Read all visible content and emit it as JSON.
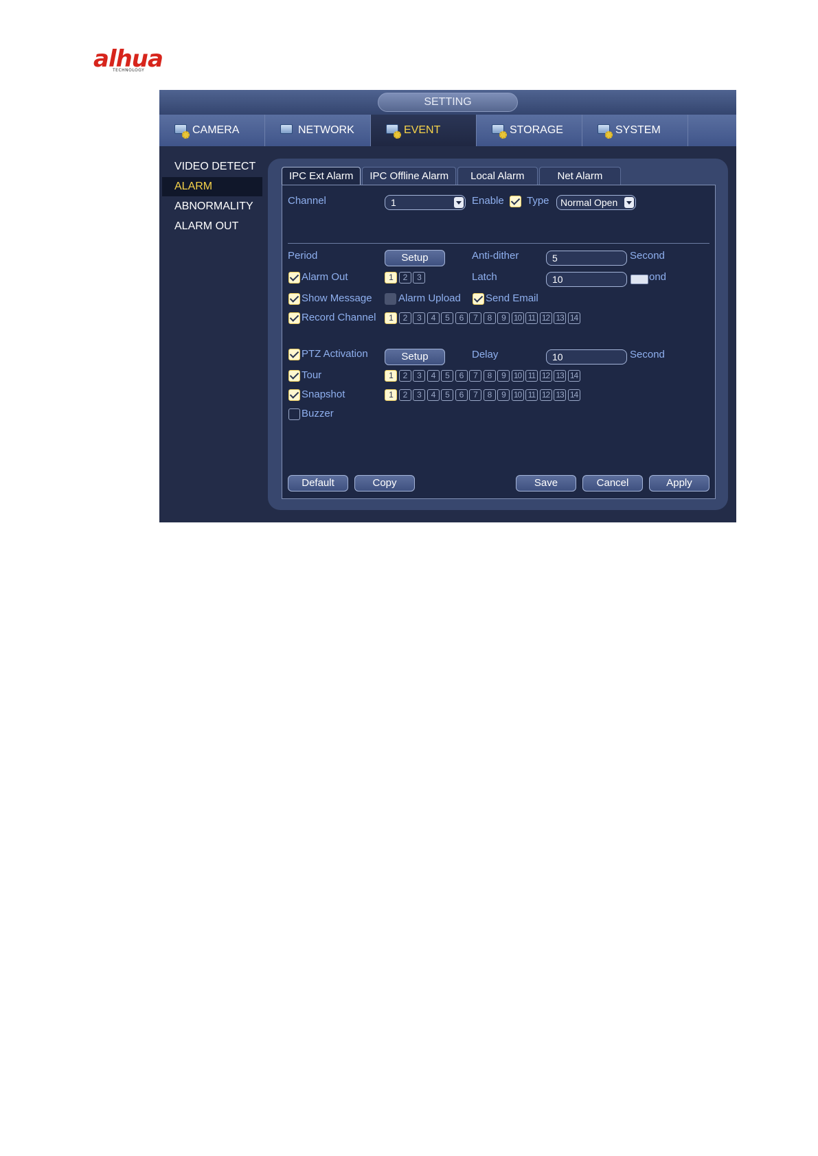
{
  "logo": {
    "text": "alhua",
    "subtext": "TECHNOLOGY"
  },
  "window": {
    "title": "SETTING"
  },
  "main_tabs": [
    {
      "label": "CAMERA",
      "icon": "camera-gear-icon"
    },
    {
      "label": "NETWORK",
      "icon": "network-icon"
    },
    {
      "label": "EVENT",
      "icon": "event-icon",
      "active": true
    },
    {
      "label": "STORAGE",
      "icon": "storage-icon"
    },
    {
      "label": "SYSTEM",
      "icon": "system-icon"
    }
  ],
  "left_menu": [
    {
      "label": "VIDEO DETECT"
    },
    {
      "label": "ALARM",
      "active": true
    },
    {
      "label": "ABNORMALITY"
    },
    {
      "label": "ALARM OUT"
    }
  ],
  "sub_tabs": [
    {
      "label": "IPC Ext Alarm",
      "active": true
    },
    {
      "label": "IPC Offline Alarm"
    },
    {
      "label": "Local Alarm"
    },
    {
      "label": "Net Alarm"
    }
  ],
  "form": {
    "channel_label": "Channel",
    "channel_value": "1",
    "enable_label": "Enable",
    "enable_checked": true,
    "type_label": "Type",
    "type_value": "Normal Open",
    "period_label": "Period",
    "period_button": "Setup",
    "anti_dither_label": "Anti-dither",
    "anti_dither_value": "5",
    "anti_dither_unit": "Second",
    "alarm_out_label": "Alarm Out",
    "alarm_out_checked": true,
    "alarm_out_channels": [
      "1",
      "2",
      "3"
    ],
    "alarm_out_selected": [
      "1"
    ],
    "latch_label": "Latch",
    "latch_value": "10",
    "latch_unit": "ond",
    "show_message_label": "Show Message",
    "show_message_checked": true,
    "alarm_upload_label": "Alarm Upload",
    "alarm_upload_checked": false,
    "send_email_label": "Send Email",
    "send_email_checked": true,
    "record_channel_label": "Record Channel",
    "record_channel_checked": true,
    "channels": [
      "1",
      "2",
      "3",
      "4",
      "5",
      "6",
      "7",
      "8",
      "9",
      "10",
      "11",
      "12",
      "13",
      "14"
    ],
    "record_channel_selected": [
      "1"
    ],
    "ptz_label": "PTZ Activation",
    "ptz_checked": true,
    "ptz_button": "Setup",
    "delay_label": "Delay",
    "delay_value": "10",
    "delay_unit": "Second",
    "tour_label": "Tour",
    "tour_checked": true,
    "tour_selected": [
      "1"
    ],
    "snapshot_label": "Snapshot",
    "snapshot_checked": true,
    "snapshot_selected": [
      "1"
    ],
    "buzzer_label": "Buzzer",
    "buzzer_checked": false
  },
  "buttons": {
    "default": "Default",
    "copy": "Copy",
    "save": "Save",
    "cancel": "Cancel",
    "apply": "Apply"
  },
  "colors": {
    "accent_yellow": "#f6d34a",
    "label_blue": "#8fb0ef",
    "logo_red": "#d7251c"
  }
}
